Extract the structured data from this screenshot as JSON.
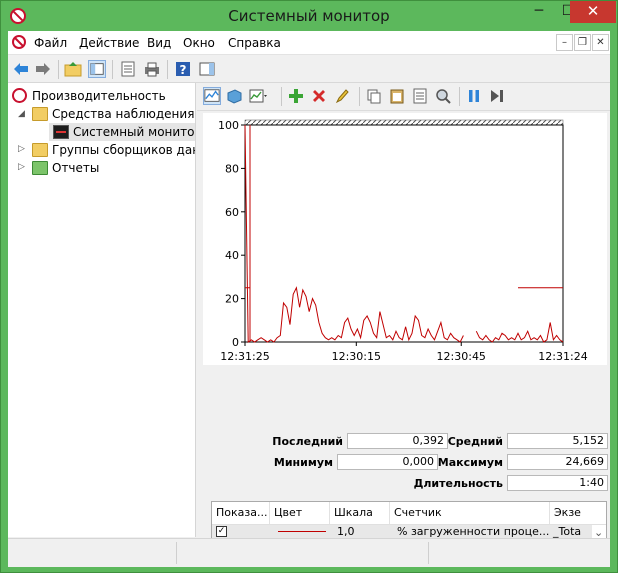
{
  "window": {
    "title": "Системный монитор",
    "close_glyph": "✕",
    "min_glyph": "─",
    "max_glyph": "☐"
  },
  "menu": {
    "items": [
      "Файл",
      "Действие",
      "Вид",
      "Окно",
      "Справка"
    ],
    "mdi_min": "–",
    "mdi_restore": "❐",
    "mdi_close": "✕"
  },
  "tree": {
    "root": "Производительность",
    "items": [
      {
        "label": "Средства наблюдения",
        "expander": "◢"
      },
      {
        "label": "Системный монитор",
        "expander": ""
      },
      {
        "label": "Группы сборщиков данн",
        "expander": "▷"
      },
      {
        "label": "Отчеты",
        "expander": "▷"
      }
    ]
  },
  "chart_data": {
    "type": "line",
    "x_ticks": [
      "12:31:25",
      "12:30:15",
      "12:30:45",
      "12:31:24"
    ],
    "y_ticks": [
      "100",
      "80",
      "60",
      "40",
      "20",
      "0"
    ],
    "ylim": [
      0,
      100
    ],
    "series": [
      {
        "color": "#c00000",
        "values": [
          100,
          0,
          1,
          0,
          1,
          2,
          1,
          0,
          1,
          0,
          2,
          3,
          18,
          16,
          8,
          22,
          25,
          16,
          24,
          21,
          14,
          20,
          17,
          9,
          4,
          2,
          1,
          2,
          1,
          3,
          2,
          9,
          11,
          6,
          3,
          6,
          2,
          10,
          12,
          9,
          4,
          2,
          14,
          8,
          2,
          3,
          1,
          5,
          2,
          1,
          7,
          1,
          4,
          12,
          10,
          3,
          2,
          6,
          3,
          1,
          5,
          9,
          2,
          1,
          4,
          2,
          1,
          0,
          3,
          2,
          1,
          8,
          5,
          2,
          1,
          3,
          1,
          0,
          2,
          1,
          4,
          3,
          1,
          2,
          1,
          4,
          1,
          2,
          5,
          1,
          2,
          1,
          3,
          0,
          1,
          9,
          1,
          3,
          1,
          0
        ]
      }
    ],
    "current_time_index": 68,
    "marker_level_left": 25,
    "marker_level_right": 25
  },
  "stats": {
    "last_label": "Последний",
    "last_value": "0,392",
    "avg_label": "Средний",
    "avg_value": "5,152",
    "min_label": "Минимум",
    "min_value": "0,000",
    "max_label": "Максимум",
    "max_value": "24,669",
    "dur_label": "Длительность",
    "dur_value": "1:40"
  },
  "counters": {
    "headers": [
      "Показа...",
      "Цвет",
      "Шкала",
      "Счетчик",
      "Экзе"
    ],
    "rows": [
      {
        "checked": "✓",
        "color": "#c00000",
        "scale": "1,0",
        "counter": "% загруженности проце...",
        "instance": "_Tota"
      }
    ],
    "scroll_down": "⌄"
  },
  "colors": {
    "accent": "#5cb85c",
    "line": "#c00000",
    "close": "#c7372f"
  }
}
